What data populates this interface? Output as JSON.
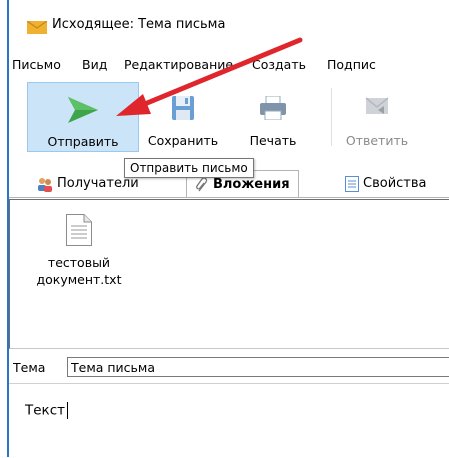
{
  "window": {
    "title": "Исходящее: Тема письма",
    "icon": "envelope-icon",
    "border_color": "#2b73c5"
  },
  "menu": {
    "items": [
      "Письмо",
      "Вид",
      "Редактирование",
      "Создать",
      "Подпис"
    ]
  },
  "toolbar": {
    "send": {
      "label": "Отправить",
      "icon": "send-icon",
      "color": "#3fa54b"
    },
    "save": {
      "label": "Сохранить",
      "icon": "save-icon"
    },
    "print": {
      "label": "Печать",
      "icon": "print-icon"
    },
    "reply": {
      "label": "Ответить",
      "icon": "reply-icon",
      "state": "disabled"
    }
  },
  "tooltip": {
    "text": "Отправить письмо"
  },
  "tabs": [
    {
      "label": "Получатели",
      "icon": "recipients-icon"
    },
    {
      "label": "Вложения",
      "icon": "attachments-icon",
      "active": true
    },
    {
      "label": "Свойства",
      "icon": "properties-icon"
    }
  ],
  "attachments": {
    "files": [
      {
        "name_line1": "тестовый",
        "name_line2": "документ.txt",
        "icon": "text-file-icon"
      }
    ]
  },
  "subject": {
    "label": "Тема",
    "value": "Тема письма"
  },
  "body": {
    "text": "Текст"
  },
  "annotation": {
    "arrow_color": "#e0262d"
  }
}
